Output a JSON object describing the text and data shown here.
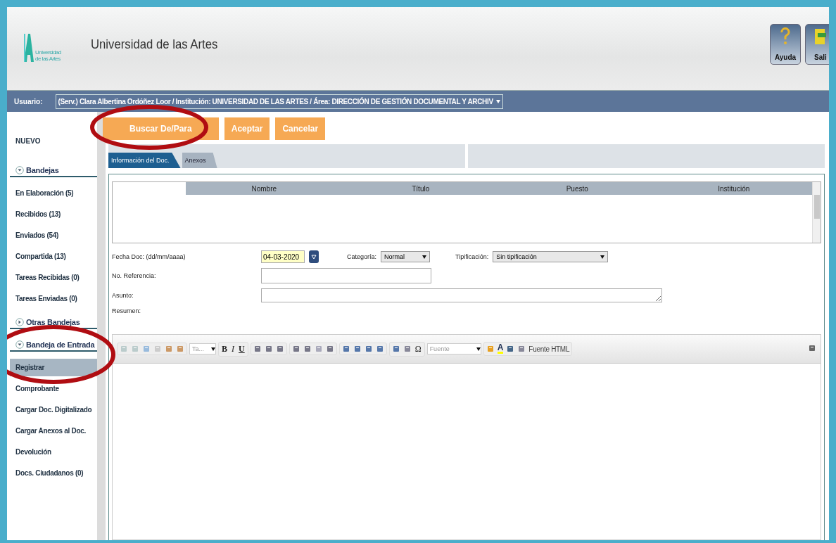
{
  "header": {
    "logo_text": [
      "Universidad",
      "de las Artes"
    ],
    "title": "Universidad de las Artes",
    "actions": [
      {
        "kind": "help",
        "label": "Ayuda"
      },
      {
        "kind": "exit",
        "label": "Sali"
      }
    ]
  },
  "user_bar": {
    "label": "Usuario:",
    "value": "(Serv.) Clara Albertina Ordóñez Loor / Institución: UNIVERSIDAD DE LAS ARTES / Área: DIRECCIÓN DE GESTIÓN DOCUMENTAL Y ARCHIV"
  },
  "sidebar": {
    "new_label": "NUEVO",
    "sections": [
      {
        "title": "Bandejas",
        "expanded": true,
        "highlighted": false,
        "items": [
          {
            "label": "En Elaboración (5)",
            "selected": false
          },
          {
            "label": "Recibidos (13)",
            "selected": false
          },
          {
            "label": "Enviados (54)",
            "selected": false
          },
          {
            "label": "Compartida (13)",
            "selected": false
          },
          {
            "label": "Tareas Recibidas (0)",
            "selected": false
          },
          {
            "label": "Tareas Enviadas (0)",
            "selected": false
          }
        ]
      },
      {
        "title": "Otras Bandejas",
        "expanded": false,
        "highlighted": false
      },
      {
        "title": "Bandeja de Entrada",
        "expanded": true,
        "highlighted": true,
        "items": [
          {
            "label": "Registrar",
            "selected": true
          },
          {
            "label": "Comprobante",
            "selected": false
          },
          {
            "label": "Cargar Doc. Digitalizado",
            "selected": false
          },
          {
            "label": "Cargar Anexos al Doc.",
            "selected": false
          },
          {
            "label": "Devolución",
            "selected": false
          },
          {
            "label": "Docs. Ciudadanos (0)",
            "selected": false
          }
        ]
      }
    ]
  },
  "actions": [
    {
      "label": "Buscar De/Para",
      "highlighted": true
    },
    {
      "label": "Aceptar",
      "highlighted": false
    },
    {
      "label": "Cancelar",
      "highlighted": false
    }
  ],
  "tabs": [
    {
      "label": "Información del Doc.",
      "selected": true
    },
    {
      "label": "Anexos",
      "selected": false
    }
  ],
  "table": {
    "columns": [
      "Nombre",
      "Título",
      "Puesto",
      "Institución"
    ]
  },
  "form": {
    "date": {
      "label": "Fecha Doc: (dd/mm/aaaa)",
      "value": "04-03-2020"
    },
    "category": {
      "label": "Categoría:",
      "value": "Normal"
    },
    "type": {
      "label": "Tipificación:",
      "value": "Sin tipificación"
    },
    "reference": {
      "label": "No. Referencia:"
    },
    "subject": {
      "label": "Asunto:"
    },
    "summary": {
      "label": "Resumen:"
    }
  },
  "editor_toolbar": {
    "style_select": "Ta...",
    "bold": "B",
    "italic": "I",
    "underline": "U",
    "special_char": "Ω",
    "font_select": "Fuente",
    "highlight": "A",
    "html_button": "Fuente HTML"
  }
}
